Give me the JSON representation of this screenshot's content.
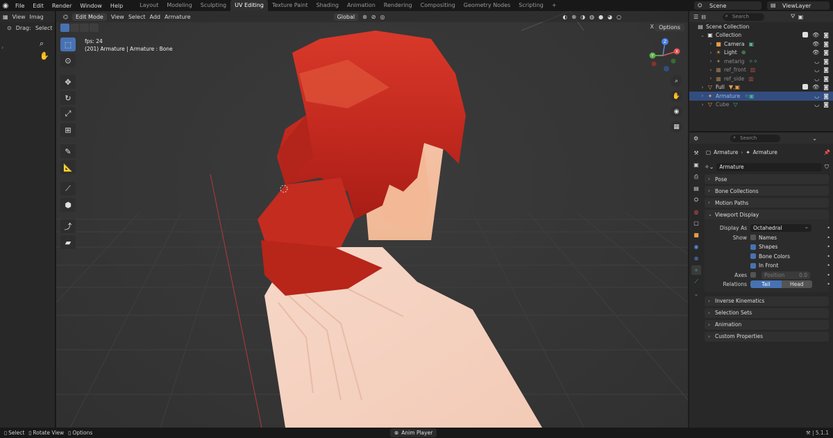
{
  "topbar": {
    "menus": [
      "File",
      "Edit",
      "Render",
      "Window",
      "Help"
    ],
    "workspaces": [
      "Layout",
      "Modeling",
      "Sculpting",
      "UV Editing",
      "Texture Paint",
      "Shading",
      "Animation",
      "Rendering",
      "Compositing",
      "Geometry Nodes",
      "Scripting"
    ],
    "active_workspace": "UV Editing",
    "add_tab": "+",
    "scene": "Scene",
    "view_layer": "ViewLayer"
  },
  "left_editor": {
    "view": "View",
    "image": "Imag",
    "drag_label": "Drag:",
    "select_label": "Select"
  },
  "viewport": {
    "mode": "Edit Mode",
    "menus": [
      "View",
      "Select",
      "Add",
      "Armature"
    ],
    "transform": "Global",
    "options": "Options",
    "xray": "X",
    "fps_line": "fps: 24",
    "object_line": "(201) Armature | Armature : Bone",
    "gizmo": {
      "z": "Z",
      "y": "Y",
      "x": "X"
    }
  },
  "outliner": {
    "search_placeholder": "Search",
    "rows": [
      {
        "label": "Scene Collection",
        "icon": "collection-icon",
        "indent": 0
      },
      {
        "label": "Collection",
        "icon": "collection-icon",
        "indent": 1
      },
      {
        "label": "Camera",
        "icon": "camera-icon",
        "indent": 2
      },
      {
        "label": "Light",
        "icon": "light-icon",
        "indent": 2
      },
      {
        "label": "metarig",
        "icon": "armature-icon",
        "indent": 2
      },
      {
        "label": "ref_front",
        "icon": "empty-image-icon",
        "indent": 2
      },
      {
        "label": "ref_side",
        "icon": "empty-image-icon",
        "indent": 2
      },
      {
        "label": "Full",
        "icon": "mesh-icon",
        "indent": 1
      },
      {
        "label": "Armature",
        "icon": "armature-icon",
        "indent": 1
      },
      {
        "label": "Cube",
        "icon": "mesh-icon",
        "indent": 1
      }
    ]
  },
  "properties": {
    "search_placeholder": "Search",
    "crumb_object": "Armature",
    "crumb_data": "Armature",
    "data_name": "Armature",
    "panels_before": [
      "Pose",
      "Bone Collections",
      "Motion Paths"
    ],
    "viewport_display": {
      "title": "Viewport Display",
      "display_as_label": "Display As",
      "display_as_value": "Octahedral",
      "show_label": "Show",
      "names": "Names",
      "shapes": "Shapes",
      "bone_colors": "Bone Colors",
      "in_front": "In Front",
      "axes_label": "Axes",
      "position_label": "Position",
      "position_value": "0.0",
      "relations_label": "Relations",
      "tail": "Tail",
      "head": "Head"
    },
    "panels_after": [
      "Inverse Kinematics",
      "Selection Sets",
      "Animation",
      "Custom Properties"
    ]
  },
  "statusbar": {
    "select": "Select",
    "rotate": "Rotate View",
    "options": "Options",
    "anim_player": "Anim Player",
    "version": "5.1.1"
  }
}
